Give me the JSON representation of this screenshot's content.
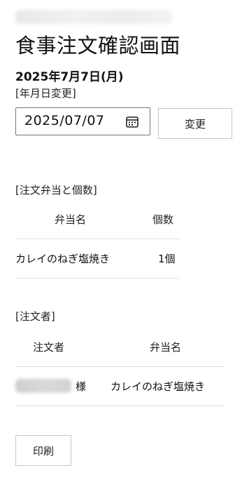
{
  "header": {
    "title": "食事注文確認画面"
  },
  "date_section": {
    "current_date": "2025年7月7日(月)",
    "change_label": "[年月日変更]",
    "date_input_value": "2025/07/07",
    "change_button_label": "変更"
  },
  "orders_section": {
    "label": "[注文弁当と個数]",
    "columns": [
      "弁当名",
      "個数"
    ],
    "rows": [
      {
        "bento": "カレイのねぎ塩焼き",
        "count": "1個"
      }
    ]
  },
  "orderer_section": {
    "label": "[注文者]",
    "columns": [
      "注文者",
      "弁当名"
    ],
    "rows": [
      {
        "honorific": "様",
        "bento": "カレイのねぎ塩焼き"
      }
    ]
  },
  "actions": {
    "print_button_label": "印刷"
  },
  "icons": {
    "date_picker": "calendar-icon"
  }
}
